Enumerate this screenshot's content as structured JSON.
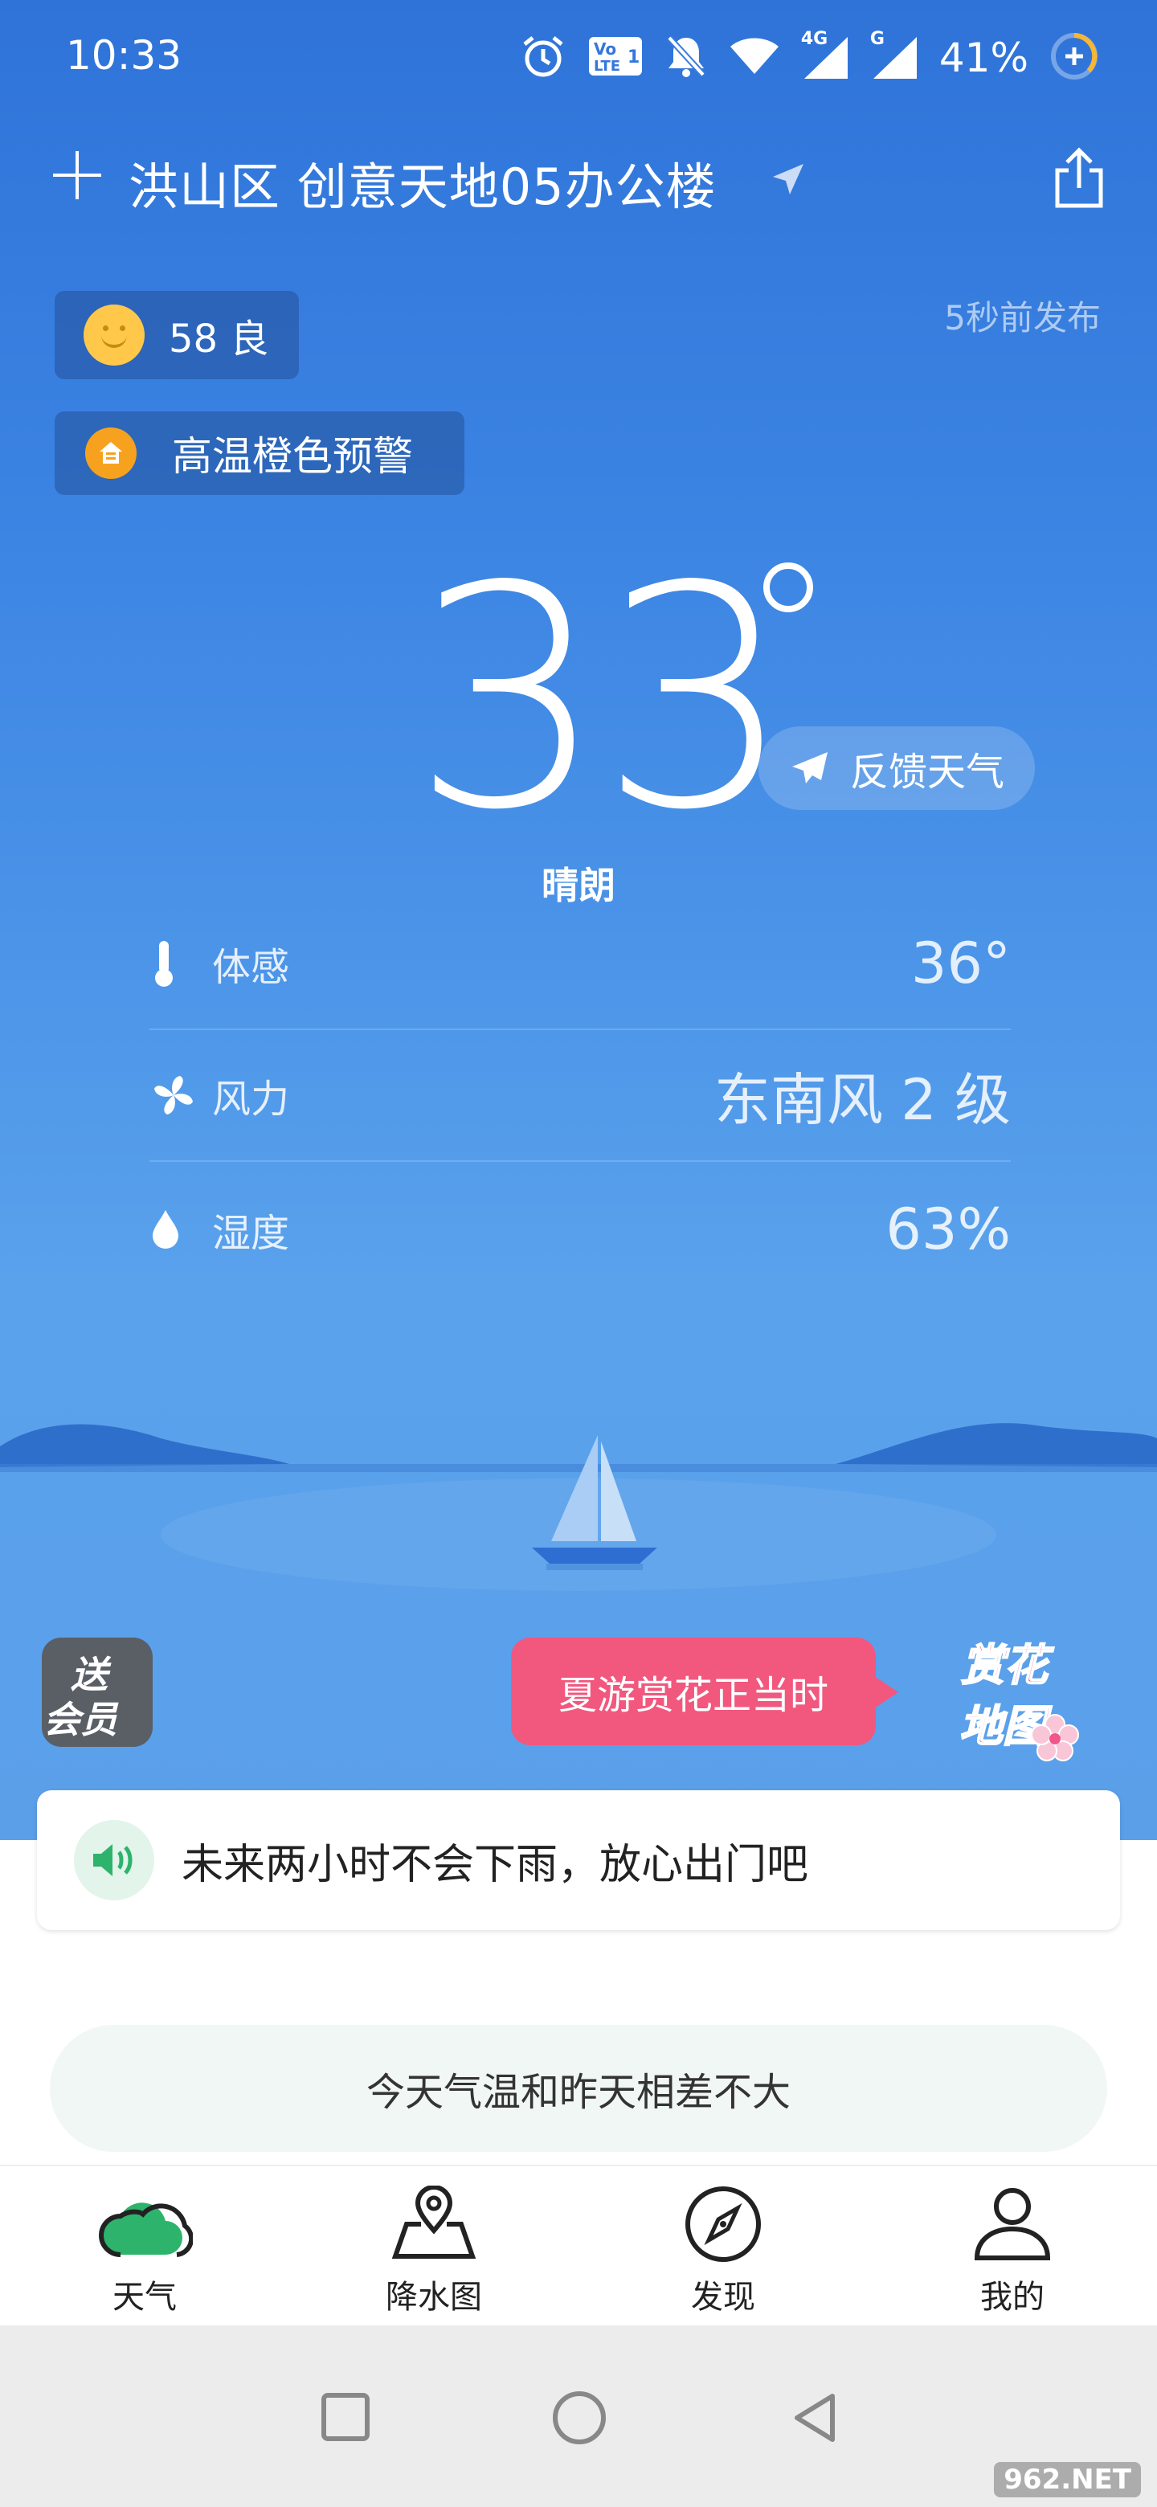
{
  "status_bar": {
    "time": "10:33",
    "network_4g": "4G",
    "network_g": "G",
    "battery": "41%"
  },
  "header": {
    "location": "洪山区 创意天地05办公楼"
  },
  "aqi": {
    "value": "58 良"
  },
  "warning": {
    "label": "高温橙色预警"
  },
  "published": "5秒前发布",
  "current": {
    "temperature": "33",
    "condition": "晴朗",
    "feedback_label": "反馈天气"
  },
  "details": [
    {
      "label": "体感",
      "value": "36°",
      "icon": "thermometer-icon"
    },
    {
      "label": "风力",
      "value": "东南风 2 级",
      "icon": "fan-icon"
    },
    {
      "label": "湿度",
      "value": "63%",
      "icon": "droplet-icon"
    }
  ],
  "promo": {
    "left_line1": "送",
    "left_line2": "会员",
    "bubble": "夏游赏花正当时",
    "flower_line1": "赏花",
    "flower_line2": "地图"
  },
  "rain_forecast": "未来两小时不会下雨，放心出门吧",
  "temperature_compare": "今天气温和昨天相差不大",
  "tabs": [
    {
      "label": "天气",
      "icon": "cloud-icon",
      "active": true
    },
    {
      "label": "降水图",
      "icon": "map-pin-icon",
      "active": false
    },
    {
      "label": "发现",
      "icon": "compass-icon",
      "active": false
    },
    {
      "label": "我的",
      "icon": "person-icon",
      "active": false
    }
  ],
  "watermark": "962.NET",
  "colors": {
    "sky_top": "#2f73d8",
    "sky_bottom": "#5b9fe9",
    "warning_badge": "#f7a21e",
    "promo_bubble": "#f2577e",
    "active_tab": "#2db36b"
  }
}
